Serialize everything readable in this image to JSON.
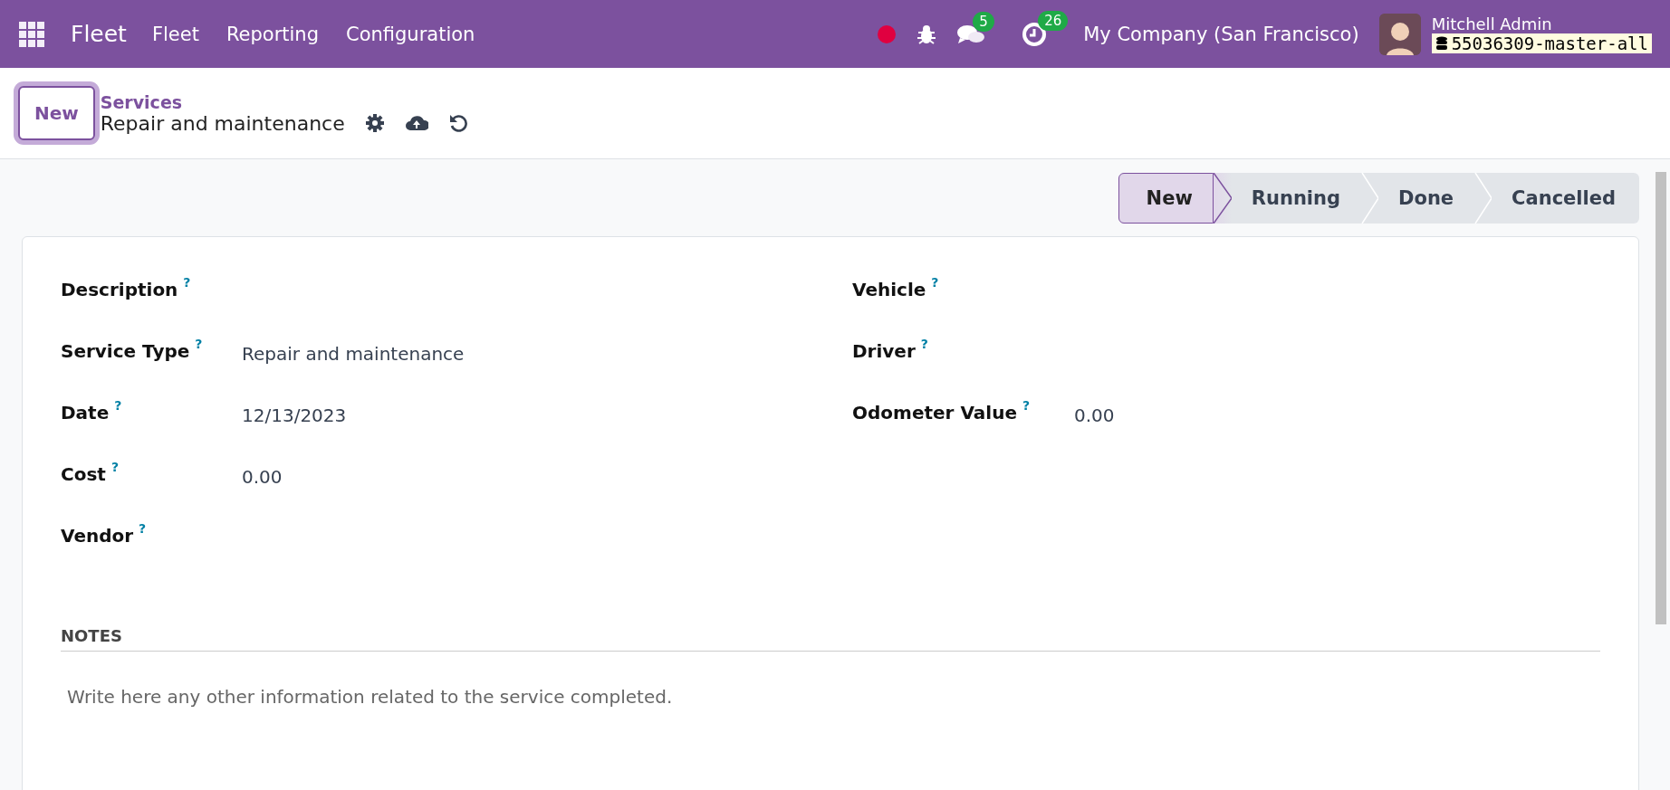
{
  "navbar": {
    "app_name": "Fleet",
    "menu": [
      "Fleet",
      "Reporting",
      "Configuration"
    ],
    "messages_badge": "5",
    "activities_badge": "26",
    "company": "My Company (San Francisco)",
    "user_name": "Mitchell Admin",
    "database": "55036309-master-all"
  },
  "control_panel": {
    "new_button": "New",
    "breadcrumb_parent": "Services",
    "record_title": "Repair and maintenance"
  },
  "statusbar": [
    {
      "label": "New",
      "selected": true
    },
    {
      "label": "Running",
      "selected": false
    },
    {
      "label": "Done",
      "selected": false
    },
    {
      "label": "Cancelled",
      "selected": false
    }
  ],
  "fields_left": [
    {
      "label": "Description",
      "help": "?"
    },
    {
      "label": "Service Type",
      "help": "?",
      "value": "Repair and maintenance"
    },
    {
      "label": "Date",
      "help": "?",
      "value": "12/13/2023"
    },
    {
      "label": "Cost",
      "help": "?",
      "value": "0.00"
    },
    {
      "label": "Vendor",
      "help": "?"
    }
  ],
  "fields_right": [
    {
      "label": "Vehicle",
      "help": "?"
    },
    {
      "label": "Driver",
      "help": "?"
    },
    {
      "label": "Odometer Value",
      "help": "?",
      "value": "0.00"
    }
  ],
  "notes": {
    "heading": "NOTES",
    "placeholder": "Write here any other information related to the service completed."
  }
}
